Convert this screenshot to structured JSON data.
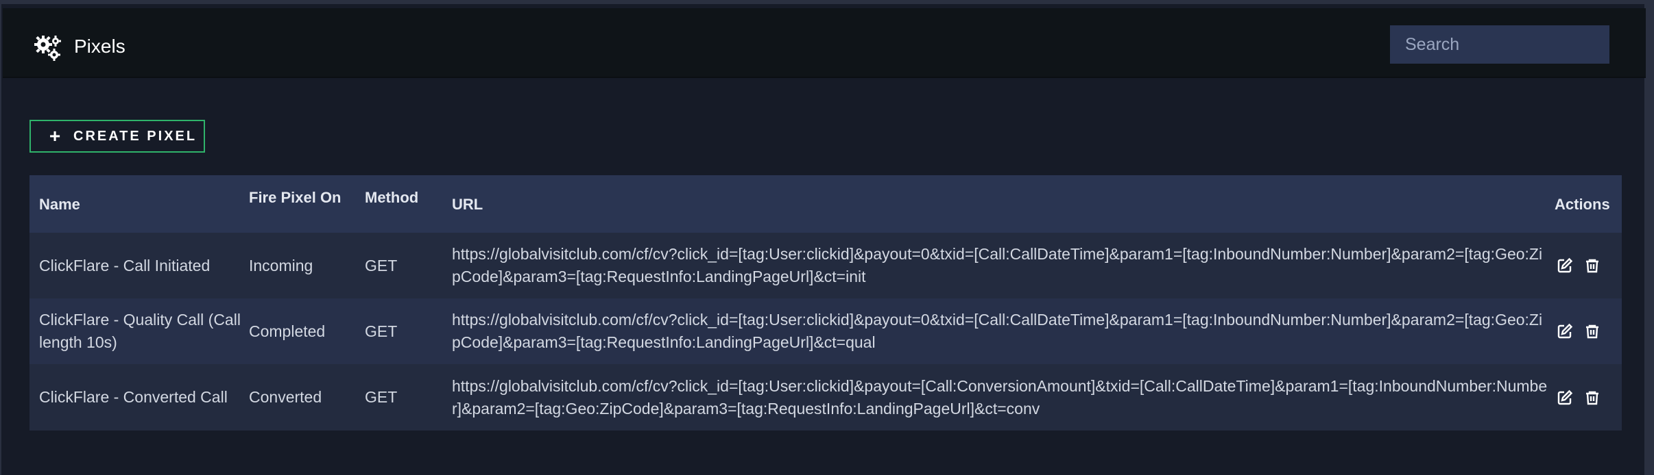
{
  "header": {
    "title": "Pixels",
    "icon": "gears-icon",
    "search_placeholder": "Search"
  },
  "toolbar": {
    "create_label": "CREATE PIXEL",
    "create_icon": "plus-icon",
    "accent_color": "#2fb36a"
  },
  "table": {
    "columns": {
      "name": "Name",
      "fire_pixel_on": "Fire Pixel On",
      "method": "Method",
      "url": "URL",
      "actions": "Actions"
    },
    "rows": [
      {
        "name": "ClickFlare - Call Initiated",
        "fire_pixel_on": "Incoming",
        "method": "GET",
        "url": "https://globalvisitclub.com/cf/cv?click_id=[tag:User:clickid]&payout=0&txid=[Call:CallDateTime]&param1=[tag:InboundNumber:Number]&param2=[tag:Geo:ZipCode]&param3=[tag:RequestInfo:LandingPageUrl]&ct=init"
      },
      {
        "name": "ClickFlare - Quality Call (Call length 10s)",
        "fire_pixel_on": "Completed",
        "method": "GET",
        "url": "https://globalvisitclub.com/cf/cv?click_id=[tag:User:clickid]&payout=0&txid=[Call:CallDateTime]&param1=[tag:InboundNumber:Number]&param2=[tag:Geo:ZipCode]&param3=[tag:RequestInfo:LandingPageUrl]&ct=qual"
      },
      {
        "name": "ClickFlare - Converted Call",
        "fire_pixel_on": "Converted",
        "method": "GET",
        "url": "https://globalvisitclub.com/cf/cv?click_id=[tag:User:clickid]&payout=[Call:ConversionAmount]&txid=[Call:CallDateTime]&param1=[tag:InboundNumber:Number]&param2=[tag:Geo:ZipCode]&param3=[tag:RequestInfo:LandingPageUrl]&ct=conv"
      }
    ],
    "row_actions": [
      "edit-icon",
      "trash-icon"
    ]
  }
}
